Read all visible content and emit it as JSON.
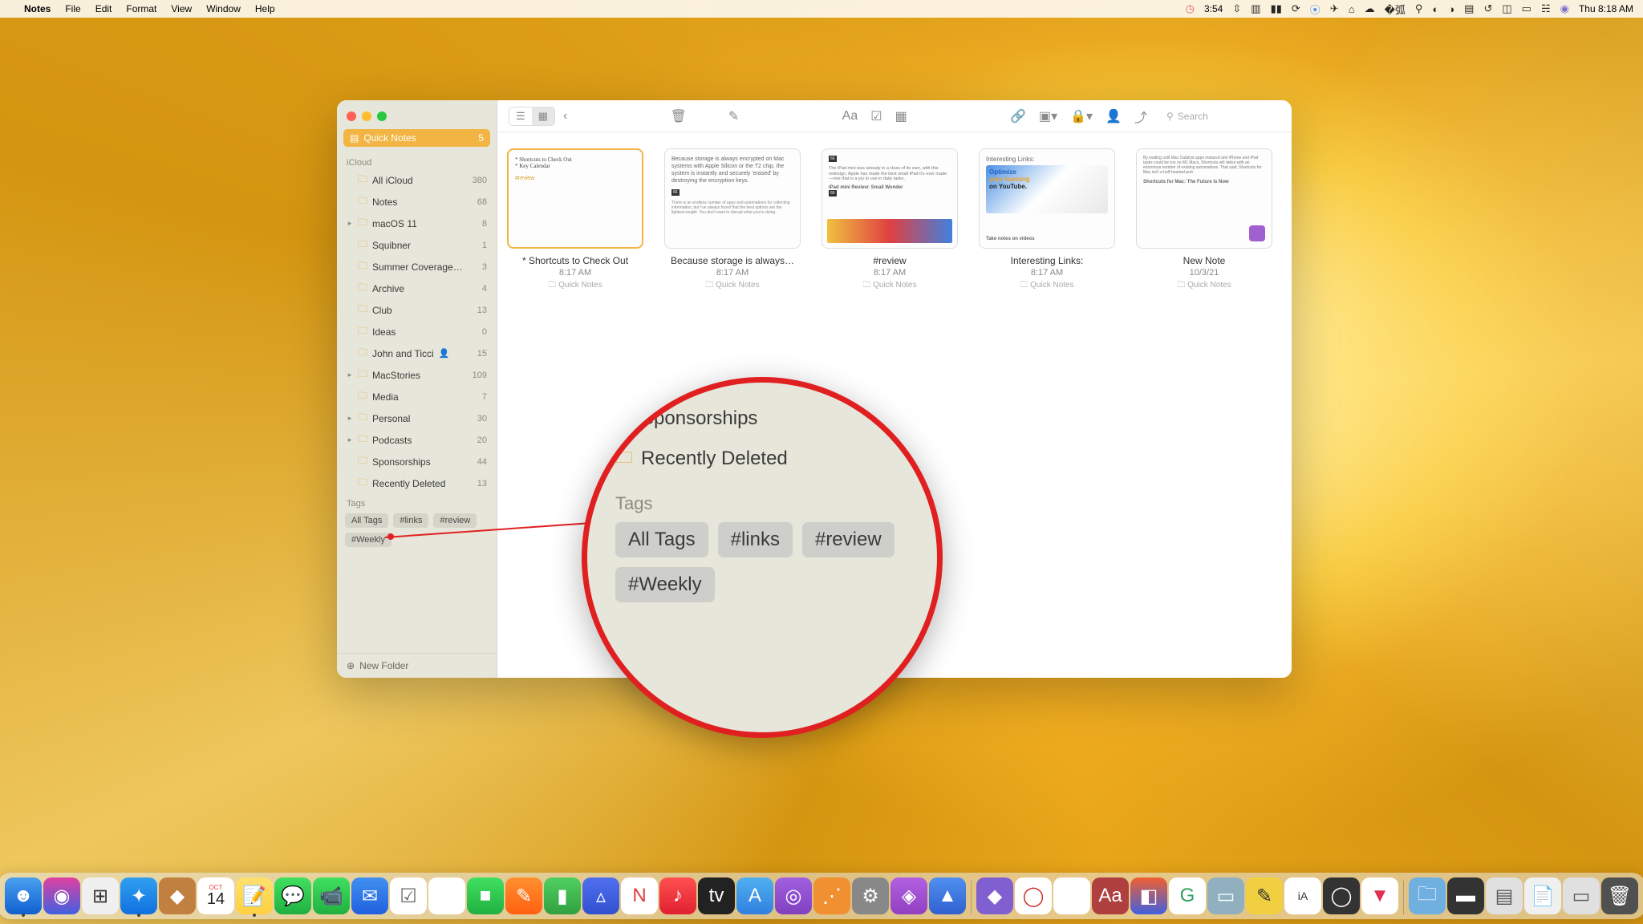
{
  "menubar": {
    "app": "Notes",
    "items": [
      "File",
      "Edit",
      "Format",
      "View",
      "Window",
      "Help"
    ],
    "timer": "3:54",
    "clock": "Thu 8:18 AM",
    "date_badge": "14"
  },
  "sidebar": {
    "quick_notes": {
      "label": "Quick Notes",
      "count": "5"
    },
    "section_icloud": "iCloud",
    "folders": [
      {
        "name": "All iCloud",
        "count": "380",
        "disclosure": false
      },
      {
        "name": "Notes",
        "count": "68",
        "disclosure": false
      },
      {
        "name": "macOS 11",
        "count": "8",
        "disclosure": true
      },
      {
        "name": "Squibner",
        "count": "1",
        "disclosure": false
      },
      {
        "name": "Summer Coverage…",
        "count": "3",
        "disclosure": false
      },
      {
        "name": "Archive",
        "count": "4",
        "disclosure": false
      },
      {
        "name": "Club",
        "count": "13",
        "disclosure": false
      },
      {
        "name": "Ideas",
        "count": "0",
        "disclosure": false
      },
      {
        "name": "John and Ticci",
        "count": "15",
        "shared": true,
        "disclosure": false
      },
      {
        "name": "MacStories",
        "count": "109",
        "disclosure": true
      },
      {
        "name": "Media",
        "count": "7",
        "disclosure": false
      },
      {
        "name": "Personal",
        "count": "30",
        "disclosure": true
      },
      {
        "name": "Podcasts",
        "count": "20",
        "disclosure": true
      },
      {
        "name": "Sponsorships",
        "count": "44",
        "disclosure": false
      },
      {
        "name": "Recently Deleted",
        "count": "13",
        "disclosure": false
      }
    ],
    "section_tags": "Tags",
    "tags": [
      "All Tags",
      "#links",
      "#review",
      "#Weekly"
    ],
    "new_folder": "New Folder"
  },
  "toolbar": {
    "search_placeholder": "Search"
  },
  "notes": [
    {
      "title": "* Shortcuts to Check Out",
      "time": "8:17 AM",
      "loc": "Quick Notes",
      "snippet_a": "* Shortcuts to Check Out",
      "snippet_b": "* Key Calendar",
      "tag": "#review",
      "selected": true
    },
    {
      "title": "Because storage is always…",
      "time": "8:17 AM",
      "loc": "Quick Notes",
      "snippet": "Because storage is always encrypted on Mac systems with Apple Silicon or the T2 chip, the system is instantly and securely 'erased' by destroying the encryption keys."
    },
    {
      "title": "#review",
      "time": "8:17 AM",
      "loc": "Quick Notes",
      "snippet": "The iPad mini was already in a class of its own, with this redesign, Apple has made the best small iPad it's ever made—one that is a joy to use in daily tasks.",
      "caption": "iPad mini Review: Small Wonder"
    },
    {
      "title": "Interesting Links:",
      "time": "8:17 AM",
      "loc": "Quick Notes",
      "heading": "Interesting Links:",
      "overlay": "Optimize your learning on YouTube.",
      "footer": "Take notes on videos"
    },
    {
      "title": "New Note",
      "time": "10/3/21",
      "loc": "Quick Notes",
      "snippet": "By waiting until Mac Catalyst apps matured and iPhone and iPad tasks could be run on M1 Macs, Shortcuts will debut with an enormous number of existing automations. That said, Shortcuts for Mac isn't a half-hearted port.",
      "caption": "Shortcuts for Mac: The Future Is Now"
    }
  ],
  "magnifier": {
    "rows": [
      "Sponsorships",
      "Recently Deleted"
    ],
    "section": "Tags",
    "tags": [
      "All Tags",
      "#links",
      "#review",
      "#Weekly"
    ]
  },
  "dock": {
    "oct": "OCT",
    "day": "14"
  }
}
